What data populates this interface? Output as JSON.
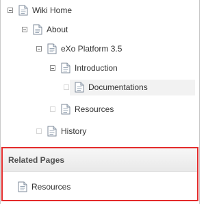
{
  "tree": {
    "root": {
      "label": "Wiki Home",
      "icon": "page-icon"
    },
    "about": {
      "label": "About",
      "icon": "page-icon"
    },
    "exo": {
      "label": "eXo Platform 3.5",
      "icon": "page-icon"
    },
    "introduction": {
      "label": "Introduction",
      "icon": "page-icon"
    },
    "documentations": {
      "label": "Documentations",
      "icon": "page-icon"
    },
    "resources": {
      "label": "Resources",
      "icon": "page-icon"
    },
    "history": {
      "label": "History",
      "icon": "page-icon"
    }
  },
  "related": {
    "title": "Related Pages",
    "items": [
      {
        "label": "Resources",
        "icon": "page-icon"
      }
    ],
    "border_color": "#e32b2b"
  }
}
